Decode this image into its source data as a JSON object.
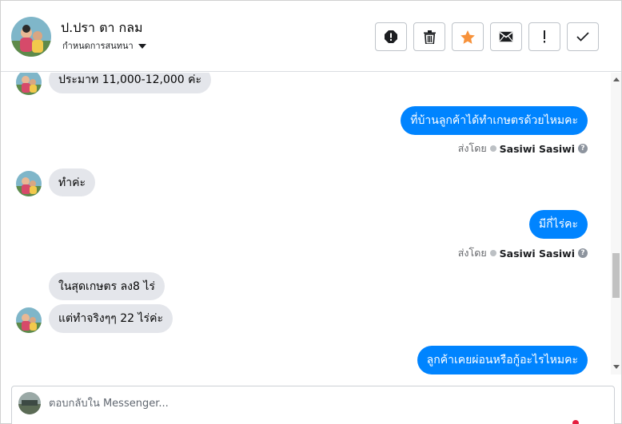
{
  "header": {
    "contact_name": "ป.ปรา ตา กลม",
    "assign_label": "กำหนดการสนทนา",
    "actions": [
      {
        "name": "report-icon",
        "label": "Report"
      },
      {
        "name": "trash-icon",
        "label": "Delete"
      },
      {
        "name": "star-icon",
        "label": "Star"
      },
      {
        "name": "mail-icon",
        "label": "Mark unread"
      },
      {
        "name": "exclamation-icon",
        "label": "Spam"
      },
      {
        "name": "check-icon",
        "label": "Done"
      }
    ],
    "star_color": "#f7923b"
  },
  "messages": [
    {
      "dir": "in",
      "text": "ประมาท 11,000-12,000 ค่ะ"
    },
    {
      "dir": "out",
      "text": "ที่บ้านลูกค้าได้ทำเกษตรด้วยไหมคะ",
      "sent_by_label": "ส่งโดย",
      "sender": "Sasiwi Sasiwi"
    },
    {
      "dir": "in",
      "text": "ทำค่ะ"
    },
    {
      "dir": "out",
      "text": "มีกี่ไร่คะ",
      "sent_by_label": "ส่งโดย",
      "sender": "Sasiwi Sasiwi"
    },
    {
      "dir": "in",
      "text": "ในสุดเกษตร ลง8 ไร่"
    },
    {
      "dir": "in",
      "text": "แต่ทำจริงๆๆ  22 ไร่ค่ะ"
    },
    {
      "dir": "out",
      "text": "ลูกค้าเคยผ่อนหรือกู้อะไรไหมคะ"
    }
  ],
  "composer": {
    "placeholder": "ตอบกลับใน Messenger..."
  },
  "colors": {
    "outgoing_bubble": "#0084ff",
    "incoming_bubble": "#e4e6eb"
  }
}
